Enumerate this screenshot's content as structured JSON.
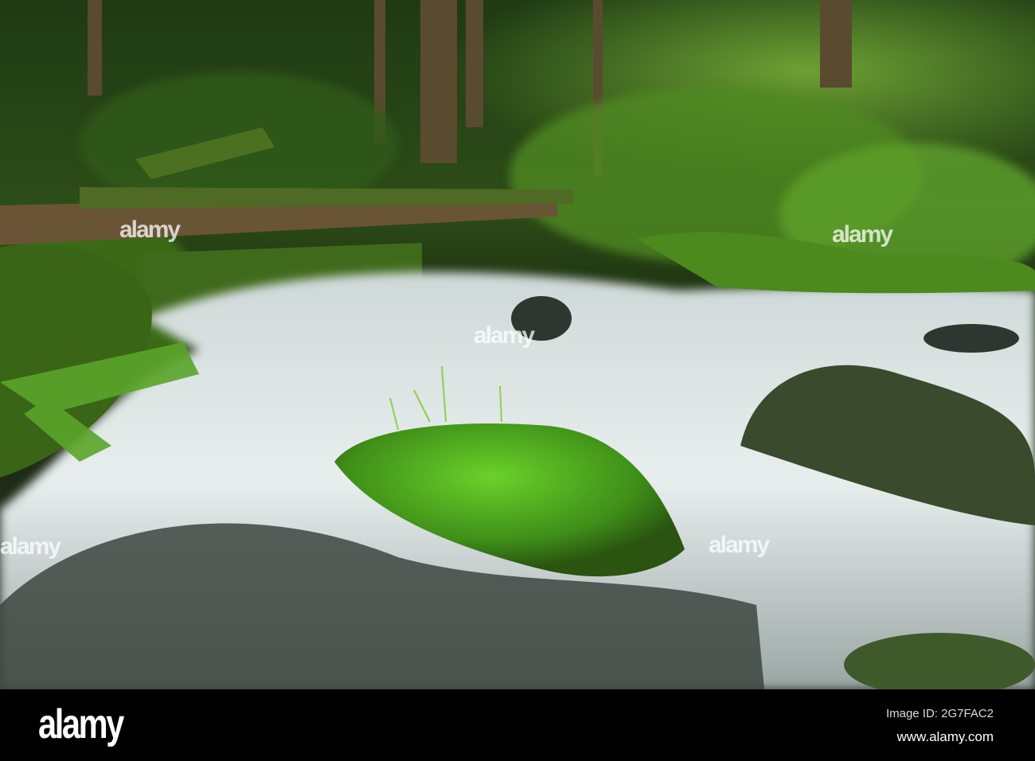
{
  "watermark": {
    "logo_text": "alamy"
  },
  "footer": {
    "logo": "alamy",
    "image_id": "Image ID: 2G7FAC2",
    "website": "www.alamy.com"
  }
}
